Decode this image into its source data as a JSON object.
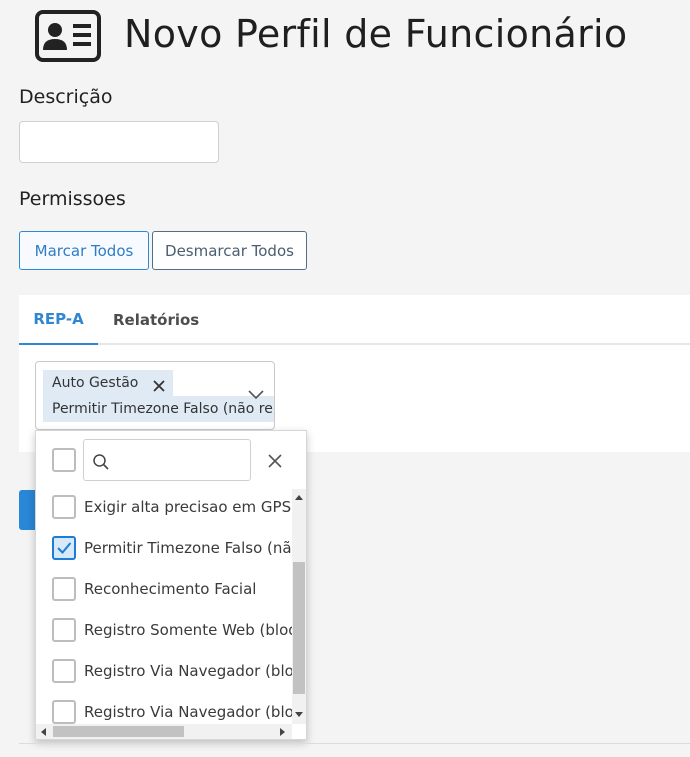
{
  "header": {
    "title": "Novo Perfil de Funcionário",
    "icon": "id-card-icon"
  },
  "description": {
    "label": "Descrição",
    "value": "",
    "placeholder": ""
  },
  "permissions": {
    "label": "Permissoes",
    "mark_all": "Marcar Todos",
    "unmark_all": "Desmarcar Todos"
  },
  "tabs": [
    {
      "label": "REP-A",
      "active": true
    },
    {
      "label": "Relatórios",
      "active": false
    }
  ],
  "multiselect": {
    "chips": [
      "Auto Gestão",
      "Permitir Timezone Falso (não re"
    ]
  },
  "dropdown": {
    "search_value": "",
    "options": [
      {
        "label": "Exigir alta precisao em GPS pa",
        "checked": false
      },
      {
        "label": "Permitir Timezone Falso (não",
        "checked": true
      },
      {
        "label": "Reconhecimento Facial",
        "checked": false
      },
      {
        "label": "Registro Somente Web (bloqu",
        "checked": false
      },
      {
        "label": "Registro Via Navegador (bloq",
        "checked": false
      },
      {
        "label": "Registro Via Navegador (bloq",
        "checked": false
      }
    ]
  },
  "colors": {
    "accent": "#2f86d2",
    "chip_bg": "#dfeaf5",
    "page_bg": "#f4f4f4"
  }
}
